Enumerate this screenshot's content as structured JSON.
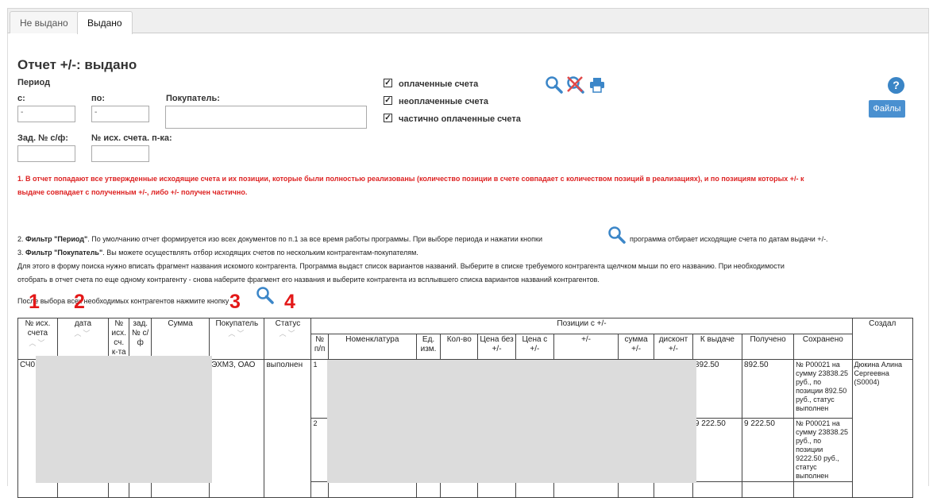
{
  "tabs": [
    {
      "label": "Не выдано",
      "active": false
    },
    {
      "label": "Выдано",
      "active": true
    }
  ],
  "title": "Отчет +/-: выдано",
  "form": {
    "period_label": "Период",
    "from_label": "с:",
    "from_value": "-",
    "to_label": "по:",
    "to_value": "-",
    "buyer_label": "Покупатель:",
    "buyer_value": "",
    "invoice_task_label": "Зад. № с/ф:",
    "invoice_task_value": "",
    "outgoing_no_label": "№ исх. счета. п-ка:",
    "outgoing_no_value": ""
  },
  "checkboxes": [
    {
      "label": "оплаченные счета",
      "checked": true
    },
    {
      "label": "неоплаченные счета",
      "checked": true
    },
    {
      "label": "частично оплаченные счета",
      "checked": true
    }
  ],
  "toolbar": {
    "icons": [
      "search-icon",
      "clear-filter-icon",
      "print-icon"
    ],
    "help_label": "?",
    "files_label": "Файлы"
  },
  "notes": {
    "red_line1": "1. В отчет попадают все утвержденные исходящие счета и их позиции, которые были полностью реализованы (количество позиции в счете совпадает с количеством позиций в реализациях), и по позициям которых +/- к",
    "red_line2": "выдаче совпадает с полученным +/-, либо +/- получен частично.",
    "p2_bold": "Фильтр \"Период\"",
    "p2_pre": "2. ",
    "p2_text": ". По умолчанию отчет формируется изо всех документов по п.1 за все время работы программы. При выборе периода и нажатии кнопки",
    "p2_tail": "программа отбирает исходящие счета по датам выдачи +/-.",
    "p3_pre": "3. ",
    "p3_bold": "Фильтр \"Покупатель\"",
    "p3_text": ". Вы можете осуществлять отбор исходящих счетов по нескольким контрагентам-покупателям.",
    "p4_line1": "Для этого в форму поиска нужно вписать фрагмент названия искомого контрагента. Программа выдаст список вариантов названий. Выберите в списке требуемого контрагента щелчком мыши по его названию. При необходимости",
    "p4_line2": "отобрать в отчет счета по еще одному контрагенту - снова наберите фрагмент его названия и выберите контрагента из всплывшего списка вариантов названий контрагентов.",
    "p5": "После выбора всех необходимых контрагентов нажмите кнопку"
  },
  "markers": [
    "1",
    "2",
    "3",
    "4"
  ],
  "table": {
    "headers": {
      "invoice_no": "№ исх. счета",
      "date": "дата",
      "out_no": "№ исх. сч. к-та",
      "task_no": "зад. № с/ф",
      "sum": "Сумма",
      "buyer": "Покупатель",
      "status": "Статус",
      "positions_group": "Позиции с +/-",
      "created": "Создал",
      "pos_no": "№ п/п",
      "nomenclature": "Номенклатура",
      "unit": "Ед. изм.",
      "qty": "Кол-во",
      "price_wo": "Цена без +/-",
      "price_with": "Цена с +/-",
      "pm": "+/-",
      "sum_pm": "сумма +/-",
      "discount_pm": "дисконт +/-",
      "to_issue": "К выдаче",
      "received": "Получено",
      "saved": "Сохранено"
    },
    "row": {
      "invoice_no": "СЧ0",
      "buyer": "ЭХМЗ, ОАО",
      "status": "выполнен",
      "created": "Дюкина Алина Сергеевна (S0004)",
      "positions": [
        {
          "no": "1",
          "to_issue": "892.50",
          "received": "892.50",
          "saved": "№ Р00021 на сумму 23838.25 руб., по позиции 892.50 руб., статус выполнен"
        },
        {
          "no": "2",
          "to_issue": "9 222.50",
          "received": "9 222.50",
          "saved": "№ Р00021 на сумму 23838.25 руб., по позиции 9222.50 руб., статус выполнен"
        }
      ]
    }
  }
}
